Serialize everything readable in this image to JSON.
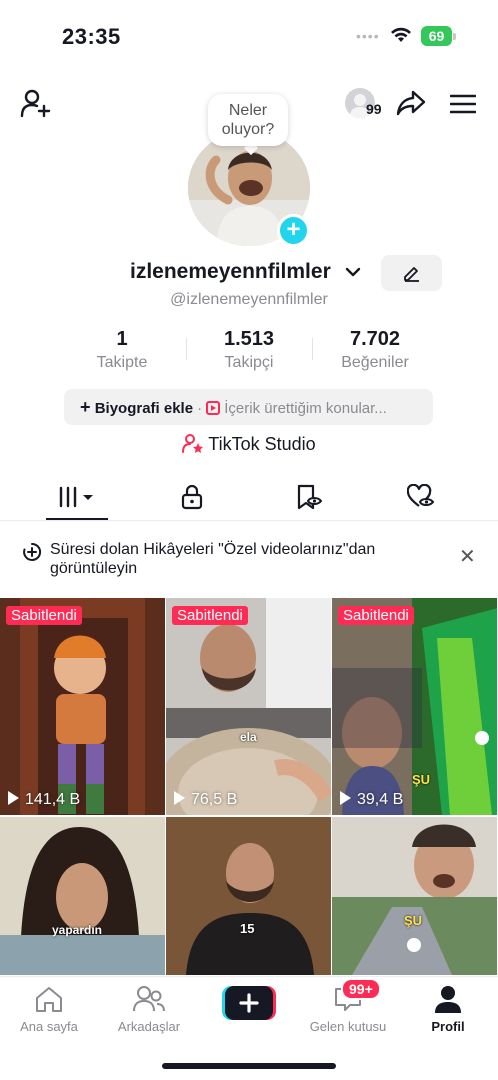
{
  "status_bar": {
    "time": "23:35",
    "battery": "69"
  },
  "header": {
    "viewers_count": "99"
  },
  "profile": {
    "bubble_text_1": "Neler",
    "bubble_text_2": "oluyor?",
    "username": "izlenemeyennfilmler",
    "handle": "@izlenemeyennfilmler",
    "stats": [
      {
        "value": "1",
        "label": "Takipte"
      },
      {
        "value": "1.513",
        "label": "Takipçi"
      },
      {
        "value": "7.702",
        "label": "Beğeniler"
      }
    ],
    "bio_add": "Biyografi ekle",
    "bio_topics": "İçerik ürettiğim konular...",
    "studio": "TikTok Studio"
  },
  "banner": {
    "text": "Süresi dolan Hikâyeleri \"Özel videolarınız\"dan görüntüleyin"
  },
  "videos": [
    {
      "pinned": "Sabitlendi",
      "views": "141,4 B",
      "caption": ""
    },
    {
      "pinned": "Sabitlendi",
      "views": "76,5 B",
      "caption": "ela"
    },
    {
      "pinned": "Sabitlendi",
      "views": "39,4 B",
      "caption": "ŞU"
    },
    {
      "pinned": "",
      "views": "",
      "caption": "yapardın"
    },
    {
      "pinned": "",
      "views": "",
      "caption": "15"
    },
    {
      "pinned": "",
      "views": "",
      "caption": "ŞU"
    }
  ],
  "nav": {
    "home": "Ana sayfa",
    "friends": "Arkadaşlar",
    "inbox": "Gelen kutusu",
    "inbox_badge": "99+",
    "profile": "Profil"
  },
  "colors": {
    "accent": "#fe2c55",
    "cyan": "#20d5ec",
    "battery": "#34c759"
  }
}
